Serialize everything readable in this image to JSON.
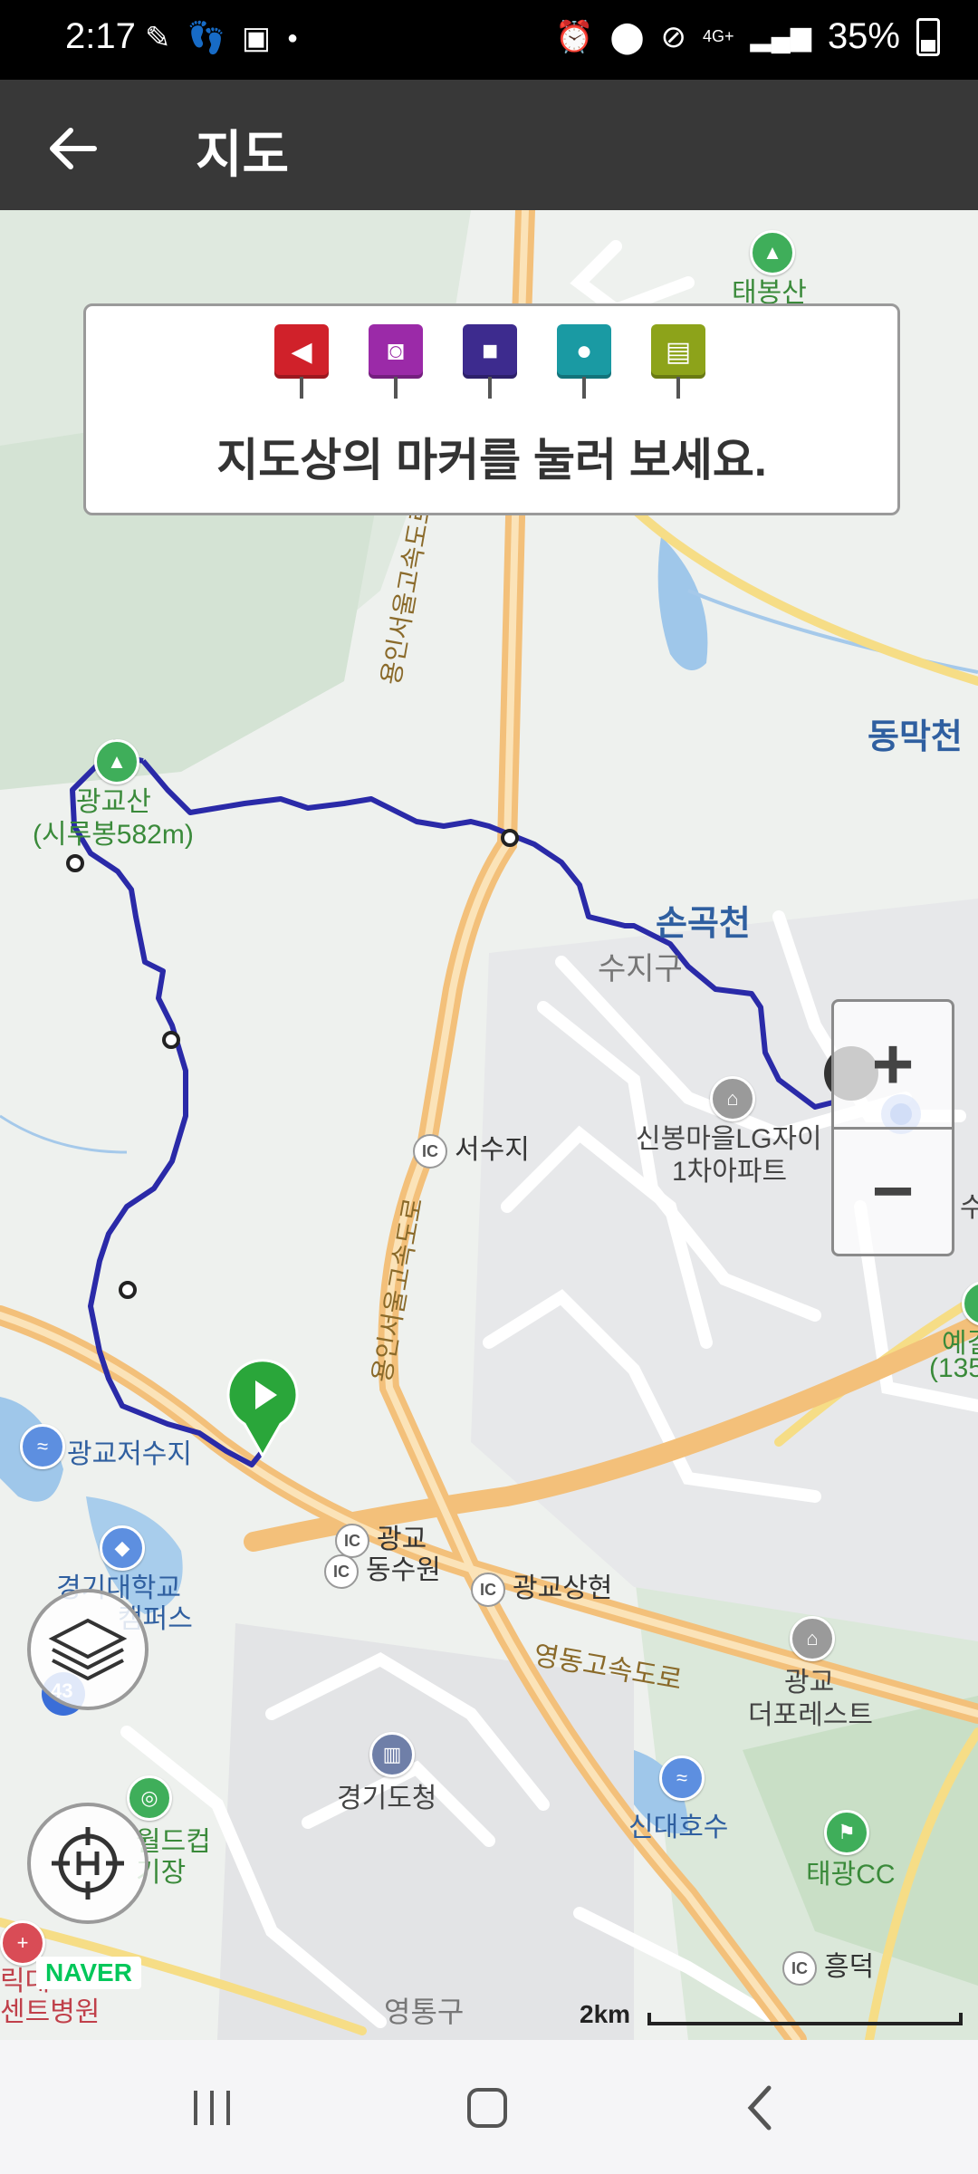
{
  "status": {
    "time": "2:17",
    "signal": "4G+",
    "battery": "35%",
    "left_icons": [
      "app-notification-icon",
      "footprint-icon",
      "image-icon",
      "dot-icon"
    ],
    "right_icons": [
      "alarm-icon",
      "location-icon",
      "blocked-icon",
      "signal-bars-icon",
      "battery-icon"
    ]
  },
  "appbar": {
    "title": "지도",
    "back_icon": "arrow-left-icon"
  },
  "marker_panel": {
    "markers": [
      {
        "name": "flag",
        "color": "#d0212a",
        "icon": "flag-icon"
      },
      {
        "name": "camera",
        "color": "#9b2aa8",
        "icon": "camera-icon"
      },
      {
        "name": "video",
        "color": "#3d2b8e",
        "icon": "video-icon"
      },
      {
        "name": "mic",
        "color": "#1a9aa3",
        "icon": "mic-icon"
      },
      {
        "name": "memo",
        "color": "#8da31a",
        "icon": "memo-icon"
      }
    ],
    "text": "지도상의 마커를 눌러 보세요."
  },
  "map": {
    "labels": {
      "taebongsan": "태봉산",
      "dongmakcheon": "동막천",
      "gwanggyosan": "광교산",
      "sirubong": "(시루봉582m)",
      "songokcheon": "손곡천",
      "suji_gu": "수지구",
      "seosuji": "서수지",
      "sinbong": "신봉마을LG자이",
      "sinbong2": "1차아파트",
      "highway_yongin_top": "용인서울고속도로",
      "highway_yongin_mid": "용인서울고속도로",
      "gwanggyo_reservoir": "광교저수지",
      "kyonggi_univ": "경기대학교",
      "kyonggi_campus": "캠퍼스",
      "gwanggyo": "광교",
      "dongsuwon": "동수원",
      "gwanggyo_sanghyeon": "광교상현",
      "yeongdong_highway": "영동고속도로",
      "gwanggyo_forest1": "광교",
      "gwanggyo_forest2": "더포레스트",
      "gyeonggi_dochung": "경기도청",
      "sindae_lake": "신대호수",
      "taegwang_cc": "태광CC",
      "worldcup1": "월드컵",
      "worldcup2": "기장",
      "heungdeok": "흥덕",
      "yeongtong": "영통구",
      "hospital1": "릭대",
      "hospital2": "센트병원",
      "yegi1": "예길",
      "yegi2": "(135",
      "su": "수",
      "road_43": "43",
      "ic": "IC"
    },
    "scale_label": "2km",
    "naver_logo": "NAVER"
  },
  "controls": {
    "zoom_in": "+",
    "zoom_out": "−",
    "layers_icon": "layers-icon",
    "location_icon": "crosshair-icon"
  },
  "navbar": {
    "recents_icon": "recents-icon",
    "home_icon": "home-icon",
    "back_icon": "back-chevron-icon"
  }
}
